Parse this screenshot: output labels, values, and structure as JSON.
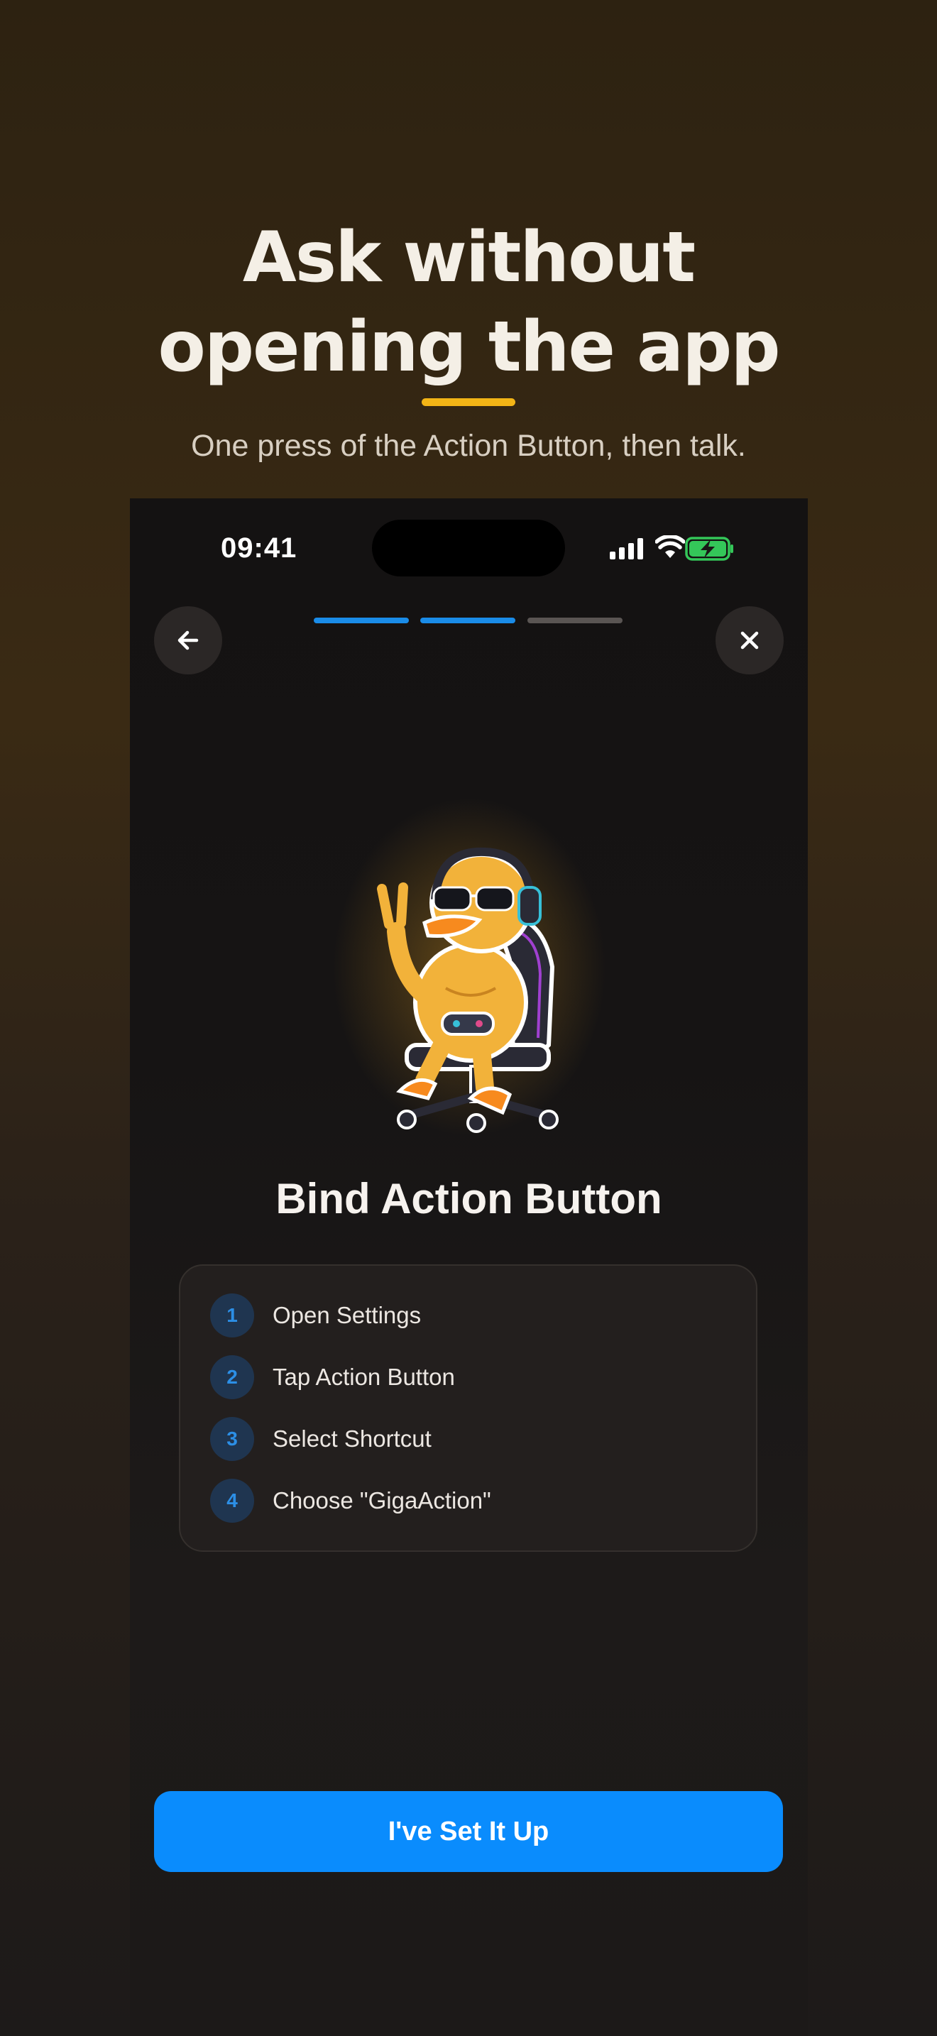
{
  "marketing": {
    "headline_line1": "Ask without",
    "headline_line2": "opening the app",
    "subheadline": "One press of the Action Button, then talk."
  },
  "status_bar": {
    "time": "09:41",
    "icons": [
      "cellular-signal-icon",
      "wifi-icon",
      "battery-charging-icon"
    ]
  },
  "nav": {
    "back_icon": "arrow-left-icon",
    "close_icon": "close-icon",
    "progress": {
      "total_steps": 3,
      "completed_steps": 2
    }
  },
  "content": {
    "illustration": "duck-mascot-illustration",
    "title": "Bind Action Button",
    "steps": [
      {
        "number": "1",
        "label": "Open Settings"
      },
      {
        "number": "2",
        "label": "Tap Action Button"
      },
      {
        "number": "3",
        "label": "Select Shortcut"
      },
      {
        "number": "4",
        "label": "Choose \"GigaAction\""
      }
    ]
  },
  "cta": {
    "label": "I've Set It Up"
  },
  "colors": {
    "accent_yellow": "#f2b416",
    "primary_blue": "#0a8cfd",
    "progress_active": "#1a8ce8",
    "progress_inactive": "#5a5553",
    "battery_green": "#34c759"
  }
}
